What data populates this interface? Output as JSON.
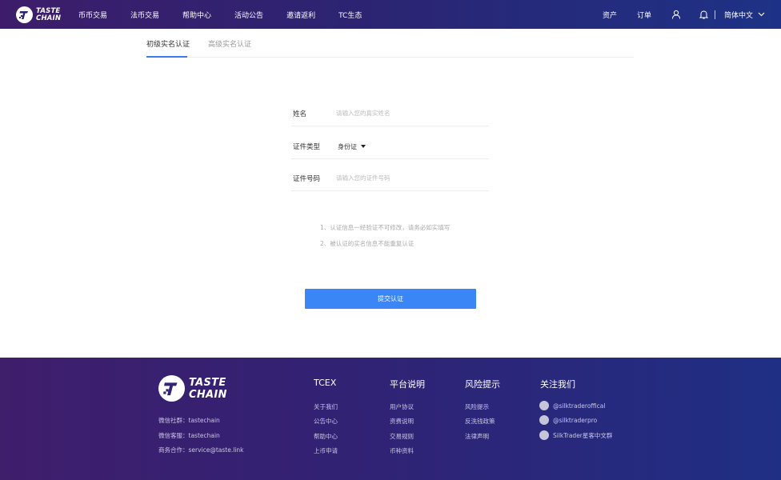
{
  "brand": {
    "line1": "TASTE",
    "line2": "CHAIN"
  },
  "header": {
    "nav": [
      "币币交易",
      "法币交易",
      "帮助中心",
      "活动公告",
      "邀请返利",
      "TC生态"
    ],
    "assets": "资产",
    "orders": "订单",
    "language": "简体中文"
  },
  "tabs": {
    "basic": "初级实名认证",
    "advanced": "高级实名认证"
  },
  "form": {
    "name_label": "姓名",
    "name_placeholder": "请输入您的真实姓名",
    "idtype_label": "证件类型",
    "idtype_value": "身份证",
    "idnum_label": "证件号码",
    "idnum_placeholder": "请输入您的证件号码"
  },
  "notes": [
    "1、认证信息一经验证不可修改，请务必如实填写",
    "2、被认证的实名信息不能重复认证"
  ],
  "submit_label": "提交认证",
  "footer": {
    "wechat_group": "微信社群：tastechain",
    "wechat_service": "微信客服：tastechain",
    "business": "商务合作：service@taste.link",
    "col_tcex": {
      "title": "TCEX",
      "links": [
        "关于我们",
        "公告中心",
        "帮助中心",
        "上币申请"
      ]
    },
    "col_platform": {
      "title": "平台说明",
      "links": [
        "用户协议",
        "资费说明",
        "交易规则",
        "币种资料"
      ]
    },
    "col_risk": {
      "title": "风险提示",
      "links": [
        "风险提示",
        "反洗钱政策",
        "法律声明"
      ]
    },
    "col_follow": {
      "title": "关注我们",
      "links": [
        "@silktraderoffical",
        "@silktraderpro",
        "SilkTrader星客中文群"
      ]
    }
  }
}
